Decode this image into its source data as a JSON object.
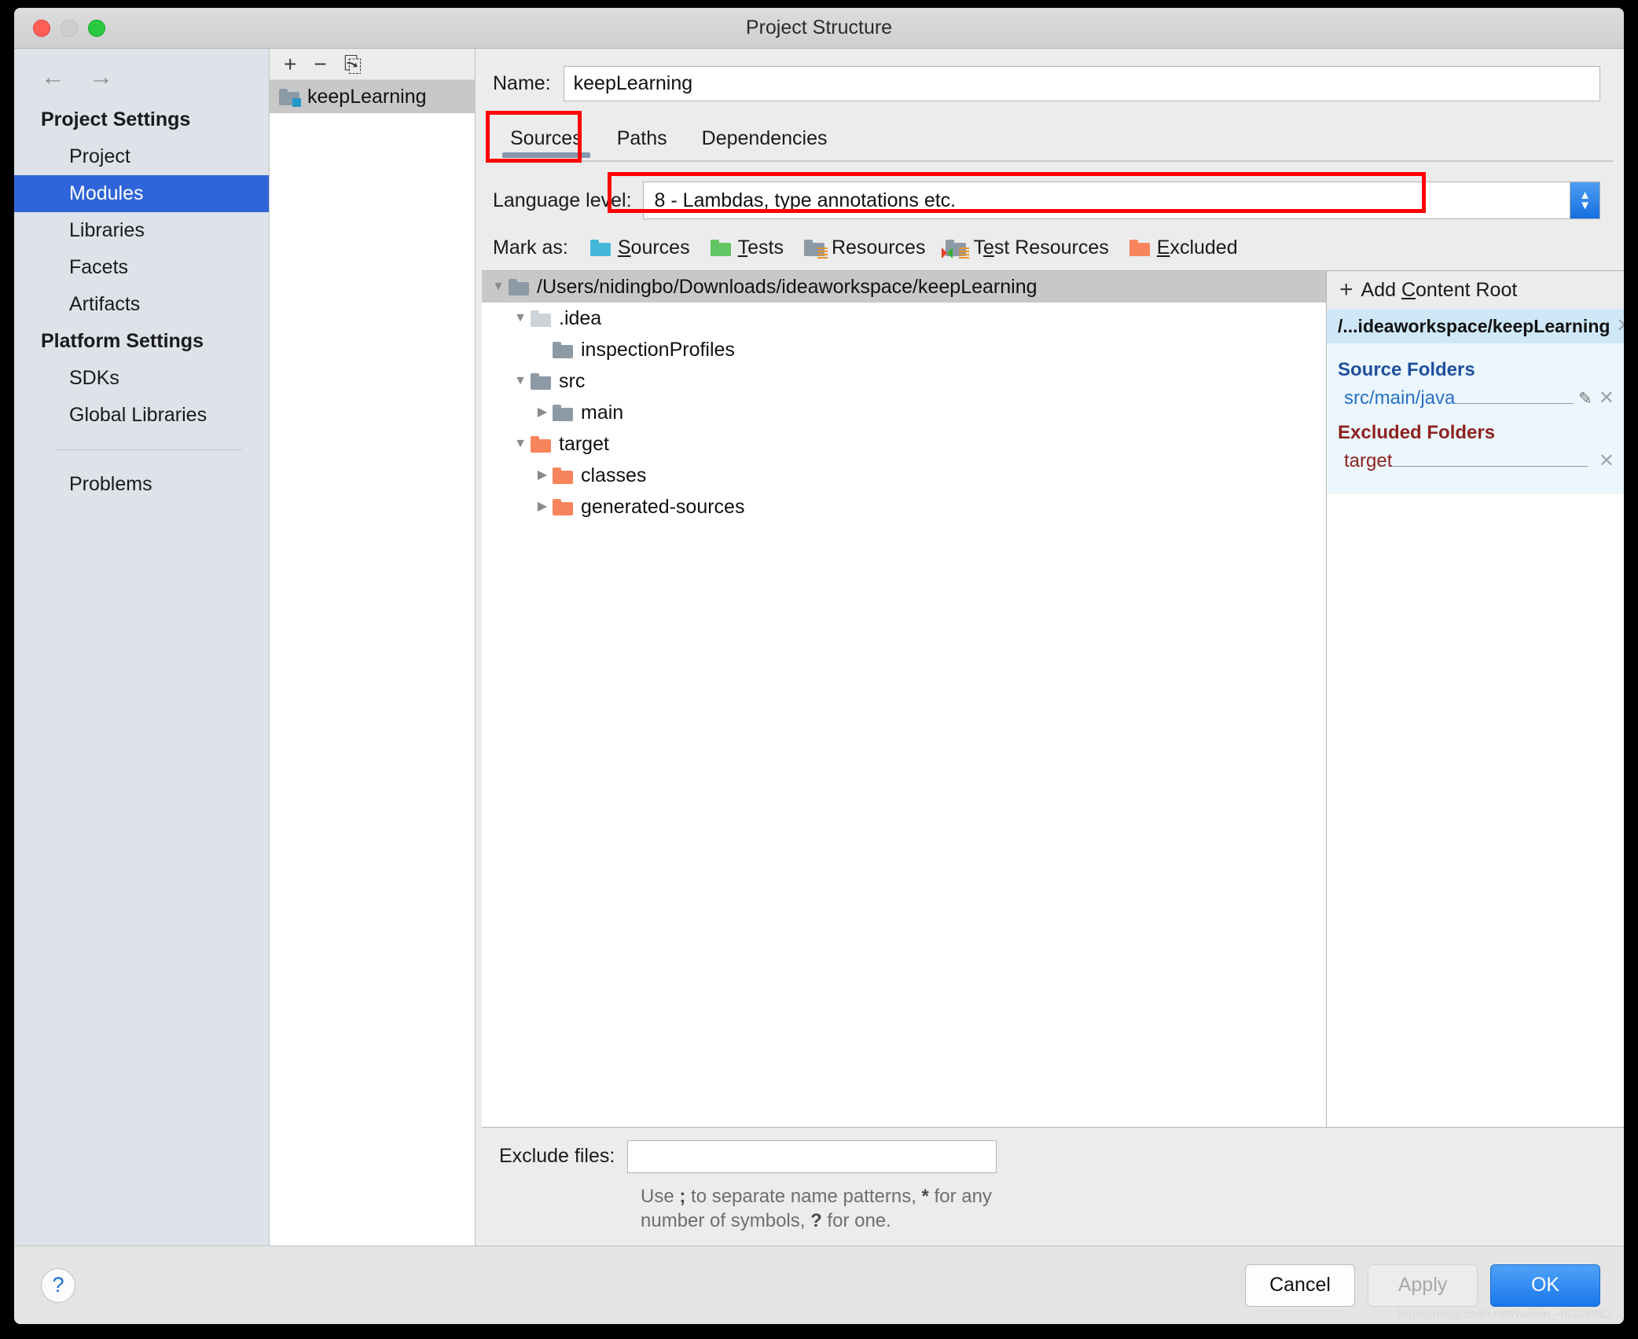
{
  "window": {
    "title": "Project Structure"
  },
  "traffic_lights": {
    "close": "close-button",
    "minimize": "minimize-button",
    "maximize": "maximize-button"
  },
  "nav": {
    "back": "←",
    "forward": "→"
  },
  "sidebar": {
    "groups": [
      {
        "label": "Project Settings",
        "items": [
          "Project",
          "Modules",
          "Libraries",
          "Facets",
          "Artifacts"
        ]
      },
      {
        "label": "Platform Settings",
        "items": [
          "SDKs",
          "Global Libraries"
        ]
      }
    ],
    "selected": "Modules",
    "extra": "Problems"
  },
  "module_toolbar": {
    "add": "+",
    "remove": "−",
    "copy": "⎘"
  },
  "module_list": {
    "items": [
      {
        "name": "keepLearning",
        "icon": "module-folder-icon",
        "selected": true
      }
    ]
  },
  "name_field": {
    "label": "Name:",
    "value": "keepLearning"
  },
  "tabs": {
    "items": [
      "Sources",
      "Paths",
      "Dependencies"
    ],
    "active": "Sources"
  },
  "language_level": {
    "label": "Language level:",
    "value": "8 - Lambdas, type annotations etc.",
    "stepper_up": "▲",
    "stepper_down": "▼"
  },
  "mark_as": {
    "label": "Mark as:",
    "buttons": [
      {
        "label": "Sources",
        "mnemonic": "S",
        "icon": "sources-folder-icon",
        "color": "#44b6da"
      },
      {
        "label": "Tests",
        "mnemonic": "T",
        "icon": "tests-folder-icon",
        "color": "#62c462"
      },
      {
        "label": "Resources",
        "mnemonic": "R",
        "icon": "resources-folder-icon",
        "color": "#8c9aa5"
      },
      {
        "label": "Test Resources",
        "mnemonic": "e",
        "icon": "test-resources-folder-icon",
        "color": "#8c9aa5"
      },
      {
        "label": "Excluded",
        "mnemonic": "E",
        "icon": "excluded-folder-icon",
        "color": "#f8845b"
      }
    ]
  },
  "tree": {
    "rows": [
      {
        "label": "/Users/nidingbo/Downloads/ideaworkspace/keepLearning",
        "indent": 0,
        "twisty": "▼",
        "icon": "gray",
        "selected": true
      },
      {
        "label": ".idea",
        "indent": 1,
        "twisty": "▼",
        "icon": "lgray",
        "selected": false
      },
      {
        "label": "inspectionProfiles",
        "indent": 2,
        "twisty": "",
        "icon": "gray",
        "selected": false
      },
      {
        "label": "src",
        "indent": 1,
        "twisty": "▼",
        "icon": "gray",
        "selected": false
      },
      {
        "label": "main",
        "indent": 2,
        "twisty": "▶",
        "icon": "gray",
        "selected": false
      },
      {
        "label": "target",
        "indent": 1,
        "twisty": "▼",
        "icon": "orange",
        "selected": false
      },
      {
        "label": "classes",
        "indent": 2,
        "twisty": "▶",
        "icon": "orange",
        "selected": false
      },
      {
        "label": "generated-sources",
        "indent": 2,
        "twisty": "▶",
        "icon": "orange",
        "selected": false
      }
    ]
  },
  "detail": {
    "add_content_root": "Add Content Root",
    "add_icon": "+",
    "root_path": "/...ideaworkspace/keepLearning",
    "close_glyph": "✕",
    "pencil_glyph": "✎",
    "sections": [
      {
        "title": "Source Folders",
        "kind": "src",
        "folders": [
          {
            "path": "src/main/java",
            "has_pencil": true
          }
        ]
      },
      {
        "title": "Excluded Folders",
        "kind": "exc",
        "folders": [
          {
            "path": "target",
            "has_pencil": false
          }
        ]
      }
    ]
  },
  "exclude_files": {
    "label": "Exclude files:",
    "value": "",
    "placeholder": "",
    "hint_line1_a": "Use ",
    "hint_line1_semi": ";",
    "hint_line1_b": " to separate name patterns, ",
    "hint_line1_star": "*",
    "hint_line1_c": " for any",
    "hint_line2_a": "number of symbols, ",
    "hint_line2_q": "?",
    "hint_line2_b": " for one."
  },
  "footer": {
    "help": "?",
    "cancel": "Cancel",
    "apply": "Apply",
    "ok": "OK"
  },
  "watermark": "https://blog.csdn.net/weixin_46326682",
  "colors": {
    "accent_selected": "#2f65d8",
    "ok_button": "#1a78ee",
    "annotation_red": "#ff0000",
    "source_blue": "#1f4f9c",
    "excluded_red": "#8e2222"
  }
}
